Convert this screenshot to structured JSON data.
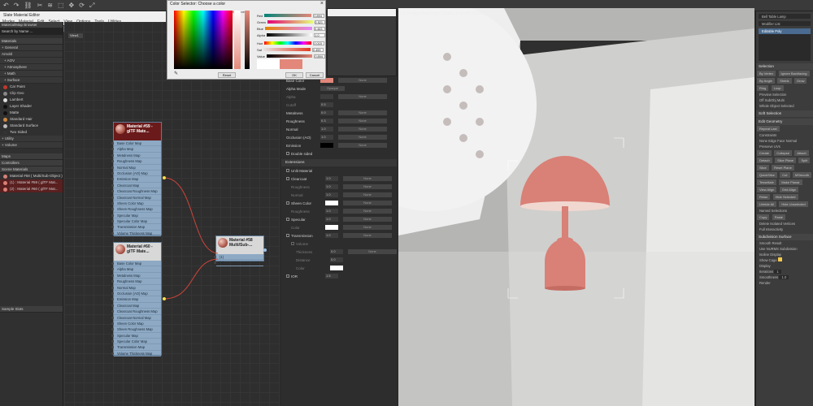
{
  "toolbar": {
    "icons": [
      "undo-icon",
      "redo-icon",
      "link-icon",
      "unlink-icon",
      "bind-icon",
      "select-icon",
      "move-icon",
      "rotate-icon",
      "scale-icon"
    ]
  },
  "slate": {
    "title": "Slate Material Editor",
    "menu": [
      "Modes",
      "Material",
      "Edit",
      "Select",
      "View",
      "Options",
      "Tools",
      "Utilities"
    ],
    "browser_title": "Material/Map Browser",
    "search_placeholder": "Search by Name ...",
    "categories": [
      "Materials",
      "+ General",
      "Arnold",
      "+ AOV",
      "+ Atmosphere",
      "+ Math",
      "+ Surface"
    ],
    "surface_items": [
      {
        "label": "Car Paint",
        "color": "#c0392b"
      },
      {
        "label": "Clip Geo",
        "color": "#888888"
      },
      {
        "label": "Lambert",
        "color": "#dddddd"
      },
      {
        "label": "Layer Shader",
        "color": "#111111"
      },
      {
        "label": "Matte",
        "color": "#111111"
      },
      {
        "label": "Standard Hair",
        "color": "#cc8844"
      },
      {
        "label": "Standard Surface",
        "color": "#bbbbbb"
      },
      {
        "label": "Two Sided",
        "color": "#333333"
      }
    ],
    "more_categories": [
      "+ Utility",
      "+ Volume",
      "Maps",
      "Controllers",
      "Scene Materials"
    ],
    "scene_items": [
      "Material #58 ( Multi/Sub-Object )",
      "(1) : Material #59 ( glTF Mat...",
      "(2) : Material #60 ( glTF Mat..."
    ],
    "sample_slots": "Sample Slots",
    "view_tab": "View1"
  },
  "nodes": {
    "node1_title": "Material #59 - glTF Mate...",
    "node2_title": "Material #60 - glTF Mate...",
    "multi_title": "Material #58 Multi/Sub-...",
    "multi_slots": [
      "(1)",
      "(2)"
    ],
    "slots": [
      "Base Color Map",
      "Alpha Map",
      "Metalness Map",
      "Roughness Map",
      "Normal Map",
      "Occlusion (AO) Map",
      "Emission Map",
      "Clearcoat Map",
      "Clearcoat Roughness Map",
      "Clearcoat Normal Map",
      "Sheen Color Map",
      "Sheen Roughness Map",
      "Specular Map",
      "Specular Color Map",
      "Transmission Map",
      "Volume Thickness Map"
    ]
  },
  "params": {
    "rows": [
      {
        "label": "Base Color",
        "value": "",
        "btn": "None"
      },
      {
        "label": "Alpha Mode",
        "value": "",
        "btn": "Opaque"
      },
      {
        "label": "Alpha",
        "value": "",
        "btn": "None"
      },
      {
        "label": "Cutoff",
        "value": "0.5",
        "btn": ""
      },
      {
        "label": "Metalness",
        "value": "0.0",
        "btn": "None"
      },
      {
        "label": "Roughness",
        "value": "0.3",
        "btn": "None"
      },
      {
        "label": "Normal",
        "value": "1.0",
        "btn": "None"
      },
      {
        "label": "Occlusion (AO)",
        "value": "1.0",
        "btn": "None"
      },
      {
        "label": "Emission",
        "value": "",
        "btn": "None"
      },
      {
        "label": "Double sided",
        "value": "",
        "btn": ""
      }
    ],
    "extensions_header": "Extensions",
    "ext_rows": [
      {
        "label": "Unlit Material",
        "value": "",
        "btn": ""
      },
      {
        "label": "Clearcoat",
        "value": "1.0",
        "btn": "None"
      },
      {
        "label": "Roughness",
        "value": "1.0",
        "btn": "None"
      },
      {
        "label": "Normal",
        "value": "1.0",
        "btn": "None"
      },
      {
        "label": "Sheen Color",
        "value": "",
        "btn": "None"
      },
      {
        "label": "Roughness",
        "value": "1.0",
        "btn": "None"
      },
      {
        "label": "Specular",
        "value": "1.0",
        "btn": "None"
      },
      {
        "label": "Color",
        "value": "",
        "btn": "None"
      },
      {
        "label": "Transmission",
        "value": "1.0",
        "btn": "None"
      },
      {
        "label": "Volume",
        "value": "",
        "btn": ""
      },
      {
        "label": "Thickness",
        "value": "0.0",
        "btn": "None"
      },
      {
        "label": "Distance",
        "value": "0.0",
        "btn": ""
      },
      {
        "label": "Color",
        "value": "",
        "btn": ""
      },
      {
        "label": "IOR",
        "value": "1.5",
        "btn": ""
      }
    ]
  },
  "color_dialog": {
    "title": "Color Selector: Choose a color",
    "hue_label": "Hue",
    "whiteness_label": "Whiteness",
    "blackness_label": "Blackness",
    "sliders": [
      {
        "label": "Red",
        "value": "0.894"
      },
      {
        "label": "Green",
        "value": "0.521"
      },
      {
        "label": "Blue",
        "value": "0.463"
      },
      {
        "label": "Alpha",
        "value": "1.0"
      },
      {
        "label": "Hue",
        "value": "0.015"
      },
      {
        "label": "Sat",
        "value": "0.459"
      },
      {
        "label": "Value",
        "value": "0.894"
      }
    ],
    "reset": "Reset",
    "ok": "OK",
    "cancel": "Cancel"
  },
  "viewport": {
    "label": "[+] [Perspective] [High Quality] [Default Shading]"
  },
  "command_panel": {
    "object_name": "Bell Table Lamp",
    "modifier_list": "Modifier List",
    "stack_item": "Editable Poly",
    "sections": [
      "Selection",
      "Soft Selection",
      "Edit Geometry",
      "Subdivision Surface"
    ],
    "selection_buttons": [
      "By Vertex",
      "Ignore Backfacing",
      "By Angle",
      "Shrink",
      "Grow",
      "Ring",
      "Loop"
    ],
    "preview_label": "Preview Selection",
    "preview_opts": [
      "Off",
      "SubObj",
      "Multi"
    ],
    "whole_object": "Whole Object Selected",
    "edit_geom_buttons": [
      "Repeat Last",
      "Create",
      "Collapse",
      "Attach",
      "Detach",
      "Slice Plane",
      "Split",
      "Slice",
      "Reset Plane",
      "QuickSlice",
      "Cut",
      "MSmooth",
      "Tessellate",
      "Make Planar",
      "View Align",
      "Grid Align",
      "Relax",
      "Hide Selected",
      "Unhide All",
      "Hide Unselected"
    ],
    "constraints_label": "Constraints",
    "constraints_opts": [
      "None",
      "Edge",
      "Face",
      "Normal"
    ],
    "preserve_uvs": "Preserve UVs",
    "named_sel": "Named Selections",
    "copy": "Copy",
    "paste": "Paste",
    "delete_iso": "Delete Isolated Vertices",
    "full_interactivity": "Full Interactivity",
    "subdiv_opts": [
      "Smooth Result",
      "Use NURMS Subdivision",
      "Isoline Display",
      "Show Cage"
    ],
    "display_label": "Display",
    "iterations_label": "Iterations",
    "iterations_value": "1",
    "smoothness_label": "Smoothness",
    "smoothness_value": "1.0",
    "render_label": "Render"
  },
  "colors": {
    "base_color": "#e2877a",
    "lamp": "#d98077"
  }
}
